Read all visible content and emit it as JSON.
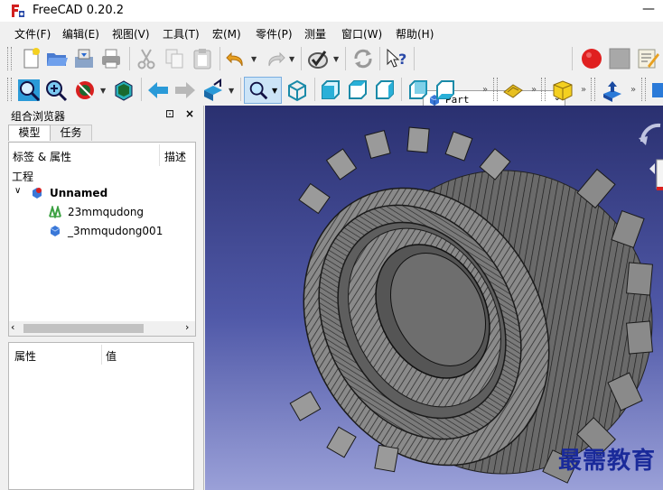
{
  "window": {
    "title": "FreeCAD 0.20.2",
    "minimize": "—"
  },
  "menu": [
    "文件(F)",
    "编辑(E)",
    "视图(V)",
    "工具(T)",
    "宏(M)",
    "零件(P)",
    "测量",
    "窗口(W)",
    "帮助(H)"
  ],
  "toolbar": {
    "workbench": "Part",
    "more": "»"
  },
  "combo_view": {
    "title": "组合浏览器",
    "float_icon": "⊡",
    "close_icon": "×",
    "tabs": [
      "模型",
      "任务"
    ],
    "tree": {
      "header_label": "标签 & 属性",
      "header_desc": "描述",
      "section": "工程",
      "document": "Unnamed",
      "items": [
        "23mmqudong",
        "_3mmqudong001"
      ]
    },
    "properties": {
      "header_prop": "属性",
      "header_value": "值"
    }
  },
  "viewport": {
    "watermark": "最需教育"
  },
  "colors": {
    "viewport_top": "#2a3070",
    "viewport_bottom": "#9aa0d8",
    "accent": "#1e62c8"
  }
}
